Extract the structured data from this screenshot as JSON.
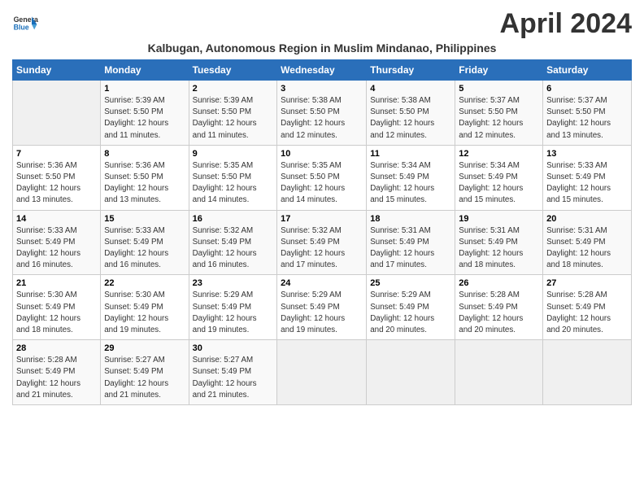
{
  "header": {
    "logo_line1": "General",
    "logo_line2": "Blue",
    "title": "April 2024",
    "subtitle": "Kalbugan, Autonomous Region in Muslim Mindanao, Philippines"
  },
  "days_of_week": [
    "Sunday",
    "Monday",
    "Tuesday",
    "Wednesday",
    "Thursday",
    "Friday",
    "Saturday"
  ],
  "weeks": [
    [
      {
        "day": "",
        "detail": ""
      },
      {
        "day": "1",
        "detail": "Sunrise: 5:39 AM\nSunset: 5:50 PM\nDaylight: 12 hours\nand 11 minutes."
      },
      {
        "day": "2",
        "detail": "Sunrise: 5:39 AM\nSunset: 5:50 PM\nDaylight: 12 hours\nand 11 minutes."
      },
      {
        "day": "3",
        "detail": "Sunrise: 5:38 AM\nSunset: 5:50 PM\nDaylight: 12 hours\nand 12 minutes."
      },
      {
        "day": "4",
        "detail": "Sunrise: 5:38 AM\nSunset: 5:50 PM\nDaylight: 12 hours\nand 12 minutes."
      },
      {
        "day": "5",
        "detail": "Sunrise: 5:37 AM\nSunset: 5:50 PM\nDaylight: 12 hours\nand 12 minutes."
      },
      {
        "day": "6",
        "detail": "Sunrise: 5:37 AM\nSunset: 5:50 PM\nDaylight: 12 hours\nand 13 minutes."
      }
    ],
    [
      {
        "day": "7",
        "detail": "Sunrise: 5:36 AM\nSunset: 5:50 PM\nDaylight: 12 hours\nand 13 minutes."
      },
      {
        "day": "8",
        "detail": "Sunrise: 5:36 AM\nSunset: 5:50 PM\nDaylight: 12 hours\nand 13 minutes."
      },
      {
        "day": "9",
        "detail": "Sunrise: 5:35 AM\nSunset: 5:50 PM\nDaylight: 12 hours\nand 14 minutes."
      },
      {
        "day": "10",
        "detail": "Sunrise: 5:35 AM\nSunset: 5:50 PM\nDaylight: 12 hours\nand 14 minutes."
      },
      {
        "day": "11",
        "detail": "Sunrise: 5:34 AM\nSunset: 5:49 PM\nDaylight: 12 hours\nand 15 minutes."
      },
      {
        "day": "12",
        "detail": "Sunrise: 5:34 AM\nSunset: 5:49 PM\nDaylight: 12 hours\nand 15 minutes."
      },
      {
        "day": "13",
        "detail": "Sunrise: 5:33 AM\nSunset: 5:49 PM\nDaylight: 12 hours\nand 15 minutes."
      }
    ],
    [
      {
        "day": "14",
        "detail": "Sunrise: 5:33 AM\nSunset: 5:49 PM\nDaylight: 12 hours\nand 16 minutes."
      },
      {
        "day": "15",
        "detail": "Sunrise: 5:33 AM\nSunset: 5:49 PM\nDaylight: 12 hours\nand 16 minutes."
      },
      {
        "day": "16",
        "detail": "Sunrise: 5:32 AM\nSunset: 5:49 PM\nDaylight: 12 hours\nand 16 minutes."
      },
      {
        "day": "17",
        "detail": "Sunrise: 5:32 AM\nSunset: 5:49 PM\nDaylight: 12 hours\nand 17 minutes."
      },
      {
        "day": "18",
        "detail": "Sunrise: 5:31 AM\nSunset: 5:49 PM\nDaylight: 12 hours\nand 17 minutes."
      },
      {
        "day": "19",
        "detail": "Sunrise: 5:31 AM\nSunset: 5:49 PM\nDaylight: 12 hours\nand 18 minutes."
      },
      {
        "day": "20",
        "detail": "Sunrise: 5:31 AM\nSunset: 5:49 PM\nDaylight: 12 hours\nand 18 minutes."
      }
    ],
    [
      {
        "day": "21",
        "detail": "Sunrise: 5:30 AM\nSunset: 5:49 PM\nDaylight: 12 hours\nand 18 minutes."
      },
      {
        "day": "22",
        "detail": "Sunrise: 5:30 AM\nSunset: 5:49 PM\nDaylight: 12 hours\nand 19 minutes."
      },
      {
        "day": "23",
        "detail": "Sunrise: 5:29 AM\nSunset: 5:49 PM\nDaylight: 12 hours\nand 19 minutes."
      },
      {
        "day": "24",
        "detail": "Sunrise: 5:29 AM\nSunset: 5:49 PM\nDaylight: 12 hours\nand 19 minutes."
      },
      {
        "day": "25",
        "detail": "Sunrise: 5:29 AM\nSunset: 5:49 PM\nDaylight: 12 hours\nand 20 minutes."
      },
      {
        "day": "26",
        "detail": "Sunrise: 5:28 AM\nSunset: 5:49 PM\nDaylight: 12 hours\nand 20 minutes."
      },
      {
        "day": "27",
        "detail": "Sunrise: 5:28 AM\nSunset: 5:49 PM\nDaylight: 12 hours\nand 20 minutes."
      }
    ],
    [
      {
        "day": "28",
        "detail": "Sunrise: 5:28 AM\nSunset: 5:49 PM\nDaylight: 12 hours\nand 21 minutes."
      },
      {
        "day": "29",
        "detail": "Sunrise: 5:27 AM\nSunset: 5:49 PM\nDaylight: 12 hours\nand 21 minutes."
      },
      {
        "day": "30",
        "detail": "Sunrise: 5:27 AM\nSunset: 5:49 PM\nDaylight: 12 hours\nand 21 minutes."
      },
      {
        "day": "",
        "detail": ""
      },
      {
        "day": "",
        "detail": ""
      },
      {
        "day": "",
        "detail": ""
      },
      {
        "day": "",
        "detail": ""
      }
    ]
  ]
}
